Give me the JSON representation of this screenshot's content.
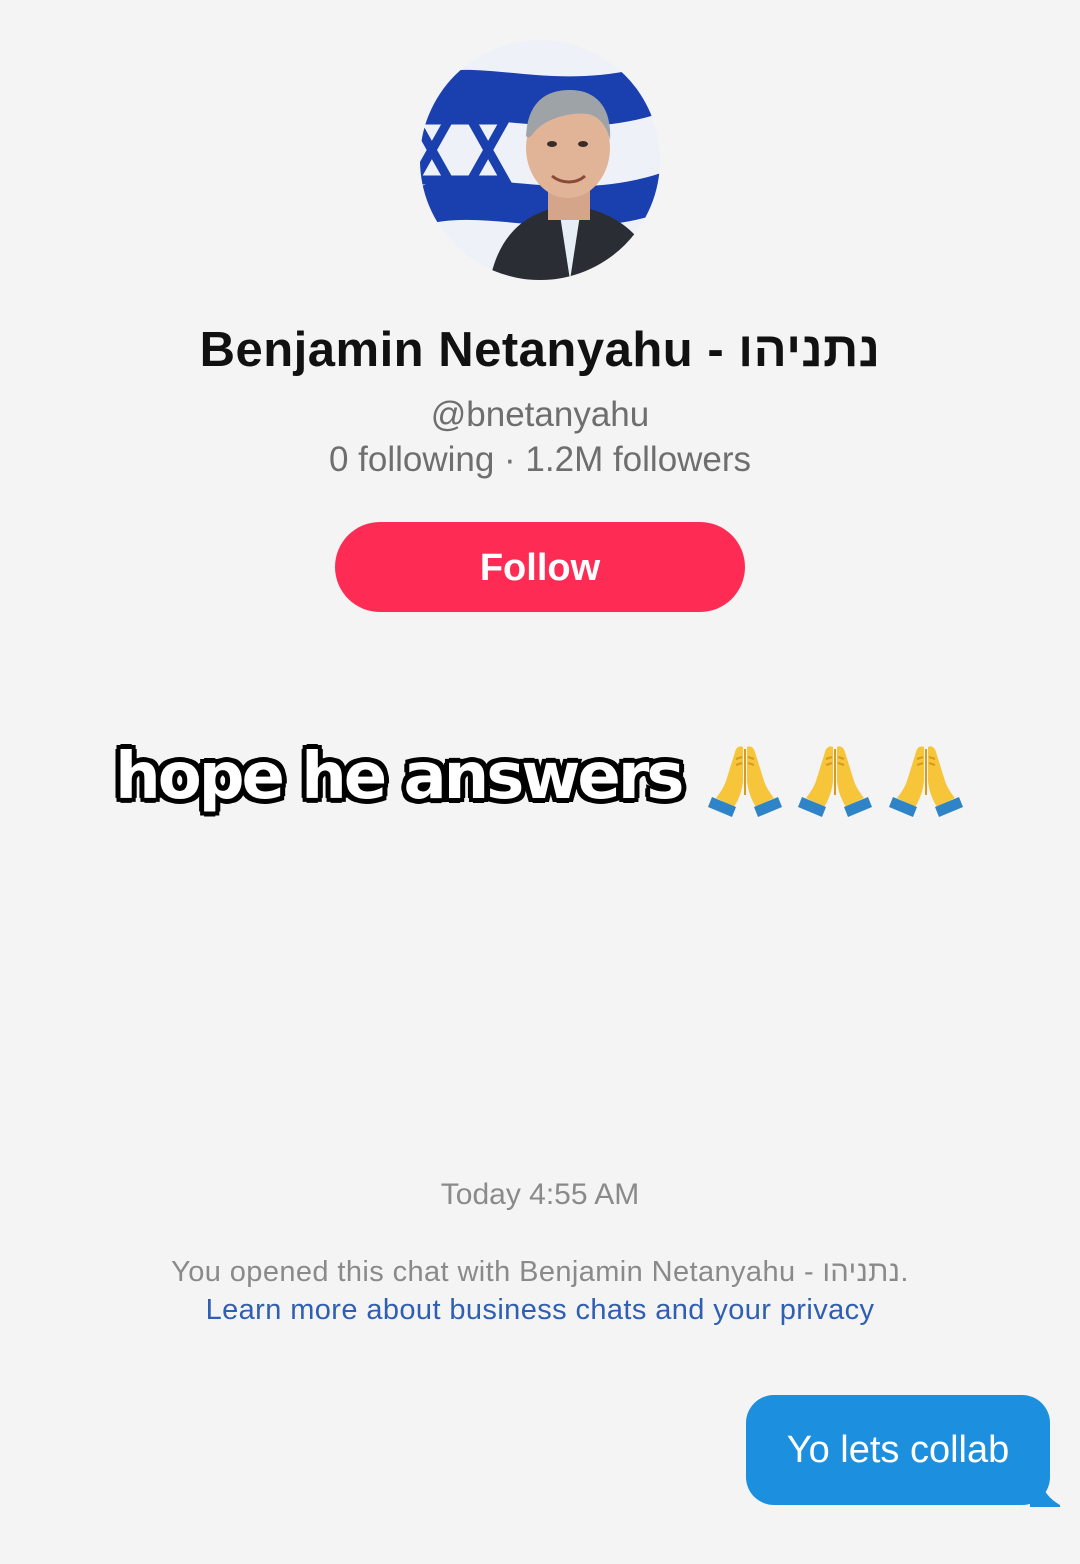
{
  "profile": {
    "name": "Benjamin Netanyahu - נתניהו",
    "handle": "@bnetanyahu",
    "stats": "0 following · 1.2M followers",
    "follow_label": "Follow"
  },
  "overlay": {
    "text": "hope he answers",
    "emoji_icon": "folded-hands-icon",
    "emoji_count": 3
  },
  "chat": {
    "timestamp": "Today 4:55 AM",
    "notice": "You opened this chat with Benjamin Netanyahu - נתניהו.",
    "privacy_link": "Learn more about business chats and your privacy",
    "messages": [
      {
        "from": "me",
        "text": "Yo lets collab"
      }
    ]
  },
  "colors": {
    "background": "#f4f4f4",
    "follow_button": "#fe2c55",
    "bubble": "#1c8fdf",
    "link": "#2f5fb3",
    "flag_blue": "#1a3fae"
  }
}
